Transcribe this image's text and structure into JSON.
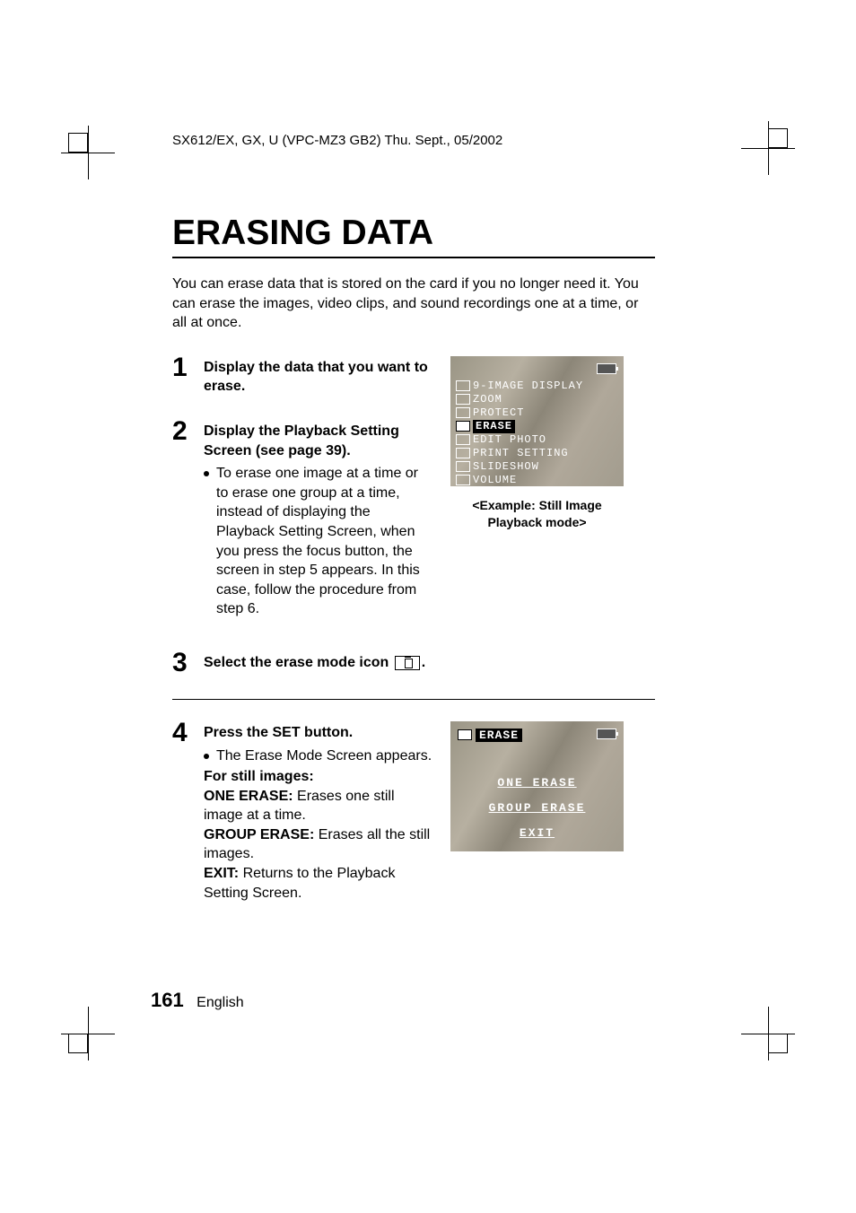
{
  "header": "SX612/EX, GX, U (VPC-MZ3 GB2)    Thu. Sept., 05/2002",
  "title": "ERASING DATA",
  "intro": "You can erase data that is stored on the card if you no longer need it. You can erase the images, video clips, and sound recordings one at a time, or all at once.",
  "steps": {
    "s1": {
      "num": "1",
      "head": "Display the data that you want to erase."
    },
    "s2": {
      "num": "2",
      "head": "Display the Playback Setting Screen (see page 39).",
      "bullet": "To erase one image at a time or to erase one group at a time, instead of displaying the Playback Setting Screen, when you press the focus button, the screen in step 5 appears. In this case, follow the procedure from step 6."
    },
    "s3": {
      "num": "3",
      "head_pre": "Select the erase mode icon ",
      "head_post": "."
    },
    "s4": {
      "num": "4",
      "head": "Press the SET button.",
      "bullet": "The Erase Mode Screen appears.",
      "sub_bold": "For still images:",
      "one_erase_term": "ONE ERASE:",
      "one_erase_desc": "Erases one still image at a time.",
      "group_erase_term": "GROUP ERASE:",
      "group_erase_desc": "Erases all the still images.",
      "exit_term": "EXIT:",
      "exit_desc": "Returns to the Playback Setting Screen."
    }
  },
  "screen1": {
    "items": [
      "9-IMAGE DISPLAY",
      "ZOOM",
      "PROTECT",
      "ERASE",
      "EDIT PHOTO",
      "PRINT SETTING",
      "SLIDESHOW",
      "VOLUME"
    ],
    "selected_index": 3,
    "caption": "<Example: Still Image Playback mode>"
  },
  "screen2": {
    "title": "ERASE",
    "opt1": "ONE ERASE",
    "opt2": "GROUP ERASE",
    "opt3": "EXIT"
  },
  "footer": {
    "page": "161",
    "lang": "English"
  }
}
